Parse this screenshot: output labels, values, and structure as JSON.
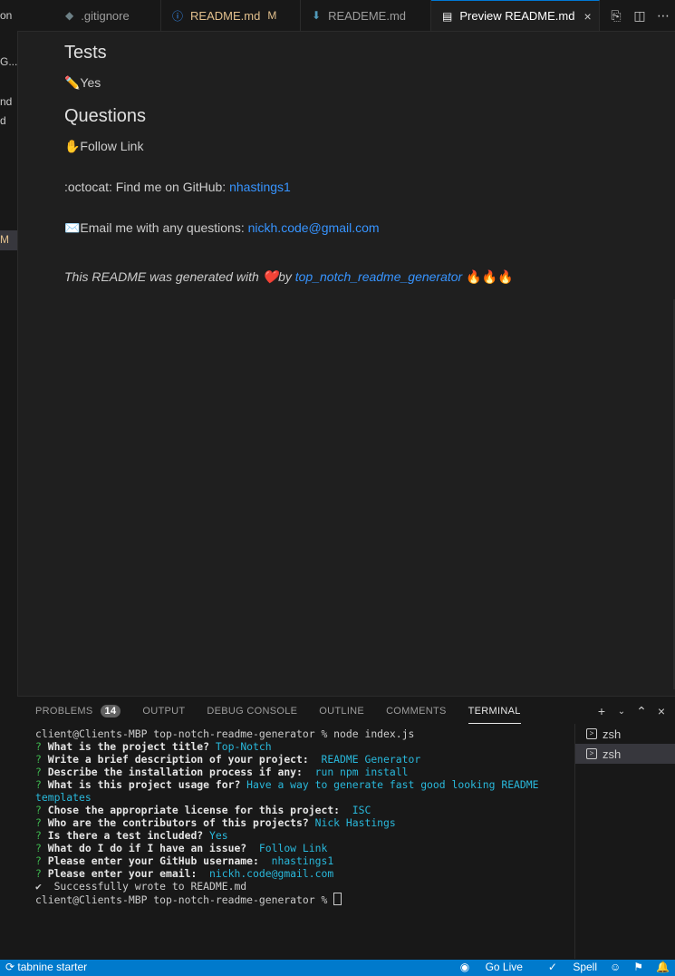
{
  "sidebar": {
    "fragments": [
      "on",
      "G...",
      "nd",
      "d"
    ],
    "selected_fragment": "M"
  },
  "tabs": [
    {
      "label": ".gitignore",
      "icon": "gitignore-icon"
    },
    {
      "label": "README.md",
      "icon": "info-icon",
      "modified": "M"
    },
    {
      "label": "READEME.md",
      "icon": "markdown-icon"
    },
    {
      "label": "Preview README.md",
      "icon": "preview-icon",
      "close": "×"
    }
  ],
  "preview": {
    "tests_heading": "Tests",
    "tests_value": "✏️Yes",
    "questions_heading": "Questions",
    "questions_value": "✋Follow Link",
    "github_prefix": ":octocat: Find me on GitHub: ",
    "github_link": "nhastings1",
    "email_prefix": "✉️Email me with any questions: ",
    "email_link": "nickh.code@gmail.com",
    "footer_prefix": "This README was generated with ❤️by ",
    "footer_link": "top_notch_readme_generator",
    "footer_suffix": " 🔥🔥🔥"
  },
  "panel": {
    "tabs": [
      {
        "label": "PROBLEMS",
        "badge": "14"
      },
      {
        "label": "OUTPUT"
      },
      {
        "label": "DEBUG CONSOLE"
      },
      {
        "label": "OUTLINE"
      },
      {
        "label": "COMMENTS"
      },
      {
        "label": "TERMINAL",
        "active": true
      }
    ],
    "actions": [
      "+",
      "⌄",
      "⌃",
      "×"
    ]
  },
  "terminal": {
    "prompt_line": "client@Clients-MBP top-notch-readme-generator % node index.js",
    "qa": [
      {
        "q": "What is the project title?",
        "a": "Top-Notch"
      },
      {
        "q": "Write a brief description of your project:",
        "a": " README Generator"
      },
      {
        "q": "Describe the installation process if any:",
        "a": " run npm install"
      },
      {
        "q": "What is this project usage for?",
        "a": "Have a way to generate fast good looking README"
      },
      {
        "q": "",
        "a": "templates"
      },
      {
        "q": "Chose the appropriate license for this project:",
        "a": " ISC"
      },
      {
        "q": "Who are the contributors of this projects?",
        "a": "Nick Hastings"
      },
      {
        "q": "Is there a test included?",
        "a": "Yes"
      },
      {
        "q": "What do I do if I have an issue?",
        "a": " Follow Link"
      },
      {
        "q": "Please enter your GitHub username:",
        "a": " nhastings1"
      },
      {
        "q": "Please enter your email:",
        "a": " nickh.code@gmail.com"
      }
    ],
    "success_line": "✔  Successfully wrote to README.md",
    "final_prompt": "client@Clients-MBP top-notch-readme-generator % "
  },
  "terminal_list": [
    "zsh",
    "zsh"
  ],
  "statusbar": {
    "left": "tabnine starter",
    "go_live": "Go Live",
    "spell": "Spell"
  },
  "colors": {
    "accent": "#007acc",
    "link": "#3794ff",
    "answer": "#29b8db",
    "question_mark": "#3fb950"
  }
}
